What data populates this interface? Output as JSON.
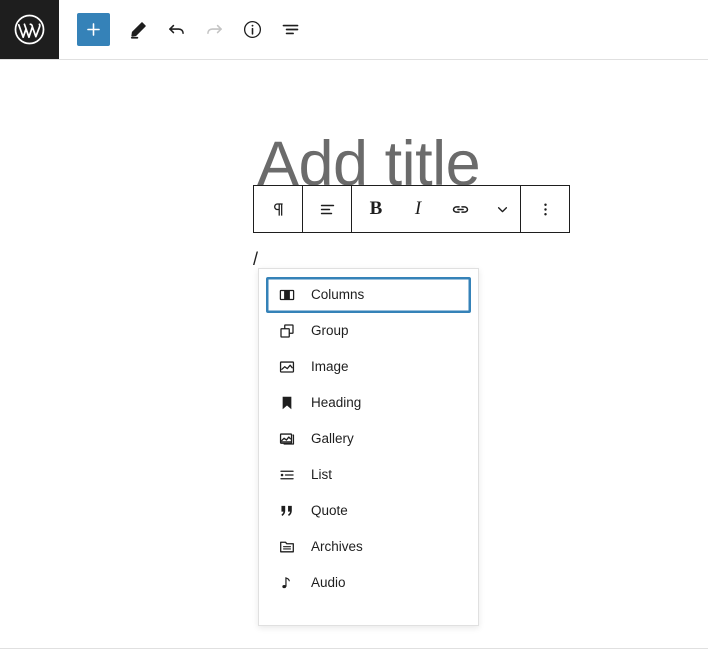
{
  "header": {
    "logo_icon": "wordpress-logo-icon",
    "tools": [
      {
        "name": "add-block-button",
        "icon": "plus-icon",
        "label": "Add block",
        "state": "primary"
      },
      {
        "name": "edit-tool-button",
        "icon": "pencil-icon",
        "label": "Tools",
        "state": "normal"
      },
      {
        "name": "undo-button",
        "icon": "undo-arrow-icon",
        "label": "Undo",
        "state": "normal"
      },
      {
        "name": "redo-button",
        "icon": "redo-arrow-icon",
        "label": "Redo",
        "state": "disabled"
      },
      {
        "name": "details-button",
        "icon": "info-circle-icon",
        "label": "Details",
        "state": "normal"
      },
      {
        "name": "list-view-button",
        "icon": "list-view-icon",
        "label": "List view",
        "state": "normal"
      }
    ]
  },
  "canvas": {
    "title_placeholder": "Add title",
    "paragraph_value": "/"
  },
  "block_toolbar": {
    "buttons": [
      {
        "name": "block-type-button",
        "icon": "paragraph-pilcrow-icon",
        "label": "¶"
      },
      {
        "name": "align-text-button",
        "icon": "align-text-icon",
        "label": "Align text"
      },
      {
        "name": "bold-button",
        "icon": "bold-icon",
        "label": "B"
      },
      {
        "name": "italic-button",
        "icon": "italic-icon",
        "label": "I"
      },
      {
        "name": "link-button",
        "icon": "link-icon",
        "label": "Link"
      },
      {
        "name": "more-rich-text-button",
        "icon": "chevron-down-icon",
        "label": "More"
      },
      {
        "name": "block-options-button",
        "icon": "vertical-dots-icon",
        "label": "Options"
      }
    ]
  },
  "inserter": {
    "items": [
      {
        "label": "Columns",
        "icon": "columns-icon",
        "selected": true
      },
      {
        "label": "Group",
        "icon": "group-icon",
        "selected": false
      },
      {
        "label": "Image",
        "icon": "image-icon",
        "selected": false
      },
      {
        "label": "Heading",
        "icon": "heading-bookmark-icon",
        "selected": false
      },
      {
        "label": "Gallery",
        "icon": "gallery-icon",
        "selected": false
      },
      {
        "label": "List",
        "icon": "list-icon",
        "selected": false
      },
      {
        "label": "Quote",
        "icon": "quote-icon",
        "selected": false
      },
      {
        "label": "Archives",
        "icon": "archives-icon",
        "selected": false
      },
      {
        "label": "Audio",
        "icon": "audio-note-icon",
        "selected": false
      }
    ]
  },
  "colors": {
    "accent_blue": "#3582b8",
    "dark": "#1e1e1e",
    "border": "#e0e0e0",
    "placeholder_gray": "#6b6b6b"
  }
}
